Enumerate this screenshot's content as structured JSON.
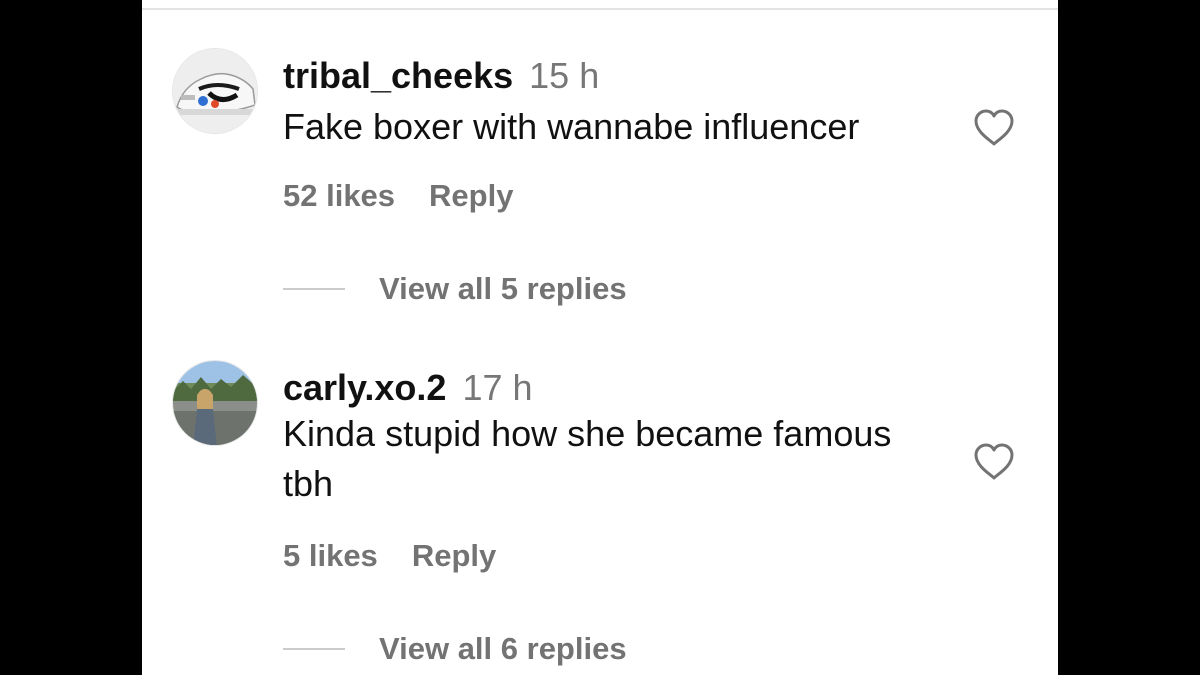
{
  "comments": [
    {
      "username": "tribal_cheeks",
      "time": "15 h",
      "text": "Fake boxer with wannabe influencer",
      "likes": "52 likes",
      "reply": "Reply",
      "view_replies": "View all 5 replies",
      "avatar_icon": "sneaker-avatar",
      "like_icon": "heart-outline-icon"
    },
    {
      "username": "carly.xo.2",
      "time": "17 h",
      "text": "Kinda stupid how she became famous tbh",
      "likes": "5 likes",
      "reply": "Reply",
      "view_replies": "View all 6 replies",
      "avatar_icon": "person-photo-avatar",
      "like_icon": "heart-outline-icon"
    }
  ],
  "colors": {
    "background": "#ffffff",
    "letterbox": "#000000",
    "primary_text": "#111111",
    "secondary_text": "#737373",
    "divider": "#e3e3e3"
  }
}
